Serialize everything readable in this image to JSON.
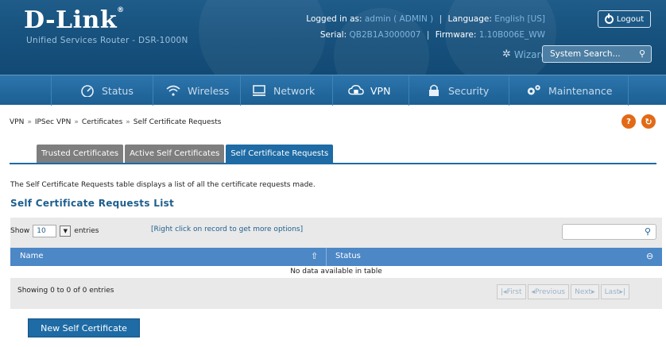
{
  "header": {
    "brand": "D-Link",
    "subtitle": "Unified Services Router - DSR-1000N",
    "logged_in_label": "Logged in as:",
    "logged_in_value": "admin ( ADMIN )",
    "language_label": "Language:",
    "language_value": "English [US]",
    "serial_label": "Serial:",
    "serial_value": "QB2B1A3000007",
    "firmware_label": "Firmware:",
    "firmware_value": "1.10B006E_WW",
    "logout_label": "Logout",
    "wizard_label": "Wizard",
    "search_label": "System Search..."
  },
  "nav": {
    "items": [
      {
        "label": "Status",
        "icon": "status-gauge-icon"
      },
      {
        "label": "Wireless",
        "icon": "wireless-icon"
      },
      {
        "label": "Network",
        "icon": "network-monitor-icon"
      },
      {
        "label": "VPN",
        "icon": "vpn-cloud-lock-icon"
      },
      {
        "label": "Security",
        "icon": "lock-icon"
      },
      {
        "label": "Maintenance",
        "icon": "gears-icon"
      }
    ],
    "active": "VPN"
  },
  "breadcrumb": {
    "items": [
      "VPN",
      "IPSec VPN",
      "Certificates",
      "Self Certificate Requests"
    ],
    "separator": "»"
  },
  "tabs": [
    {
      "label": "Trusted Certificates",
      "active": false
    },
    {
      "label": "Active Self Certificates",
      "active": false
    },
    {
      "label": "Self Certificate Requests",
      "active": true
    }
  ],
  "description": "The Self Certificate Requests table displays a list of all the certificate requests made.",
  "list_title": "Self Certificate Requests List",
  "table": {
    "show_label": "Show",
    "show_value": "10",
    "entries_label": "entries",
    "right_click_hint": "[Right click on record to get more options]",
    "columns": [
      "Name",
      "Status"
    ],
    "empty_message": "No data available in table",
    "info": "Showing 0 to 0 of 0 entries",
    "pager": [
      "First",
      "Previous",
      "Next",
      "Last"
    ]
  },
  "new_button_label": "New Self Certificate",
  "colors": {
    "header_bg": "#16507c",
    "nav_bg": "#2c75ac",
    "accent_blue": "#1e6ba5",
    "help_orange": "#e26a16",
    "table_header": "#4c87c6"
  }
}
